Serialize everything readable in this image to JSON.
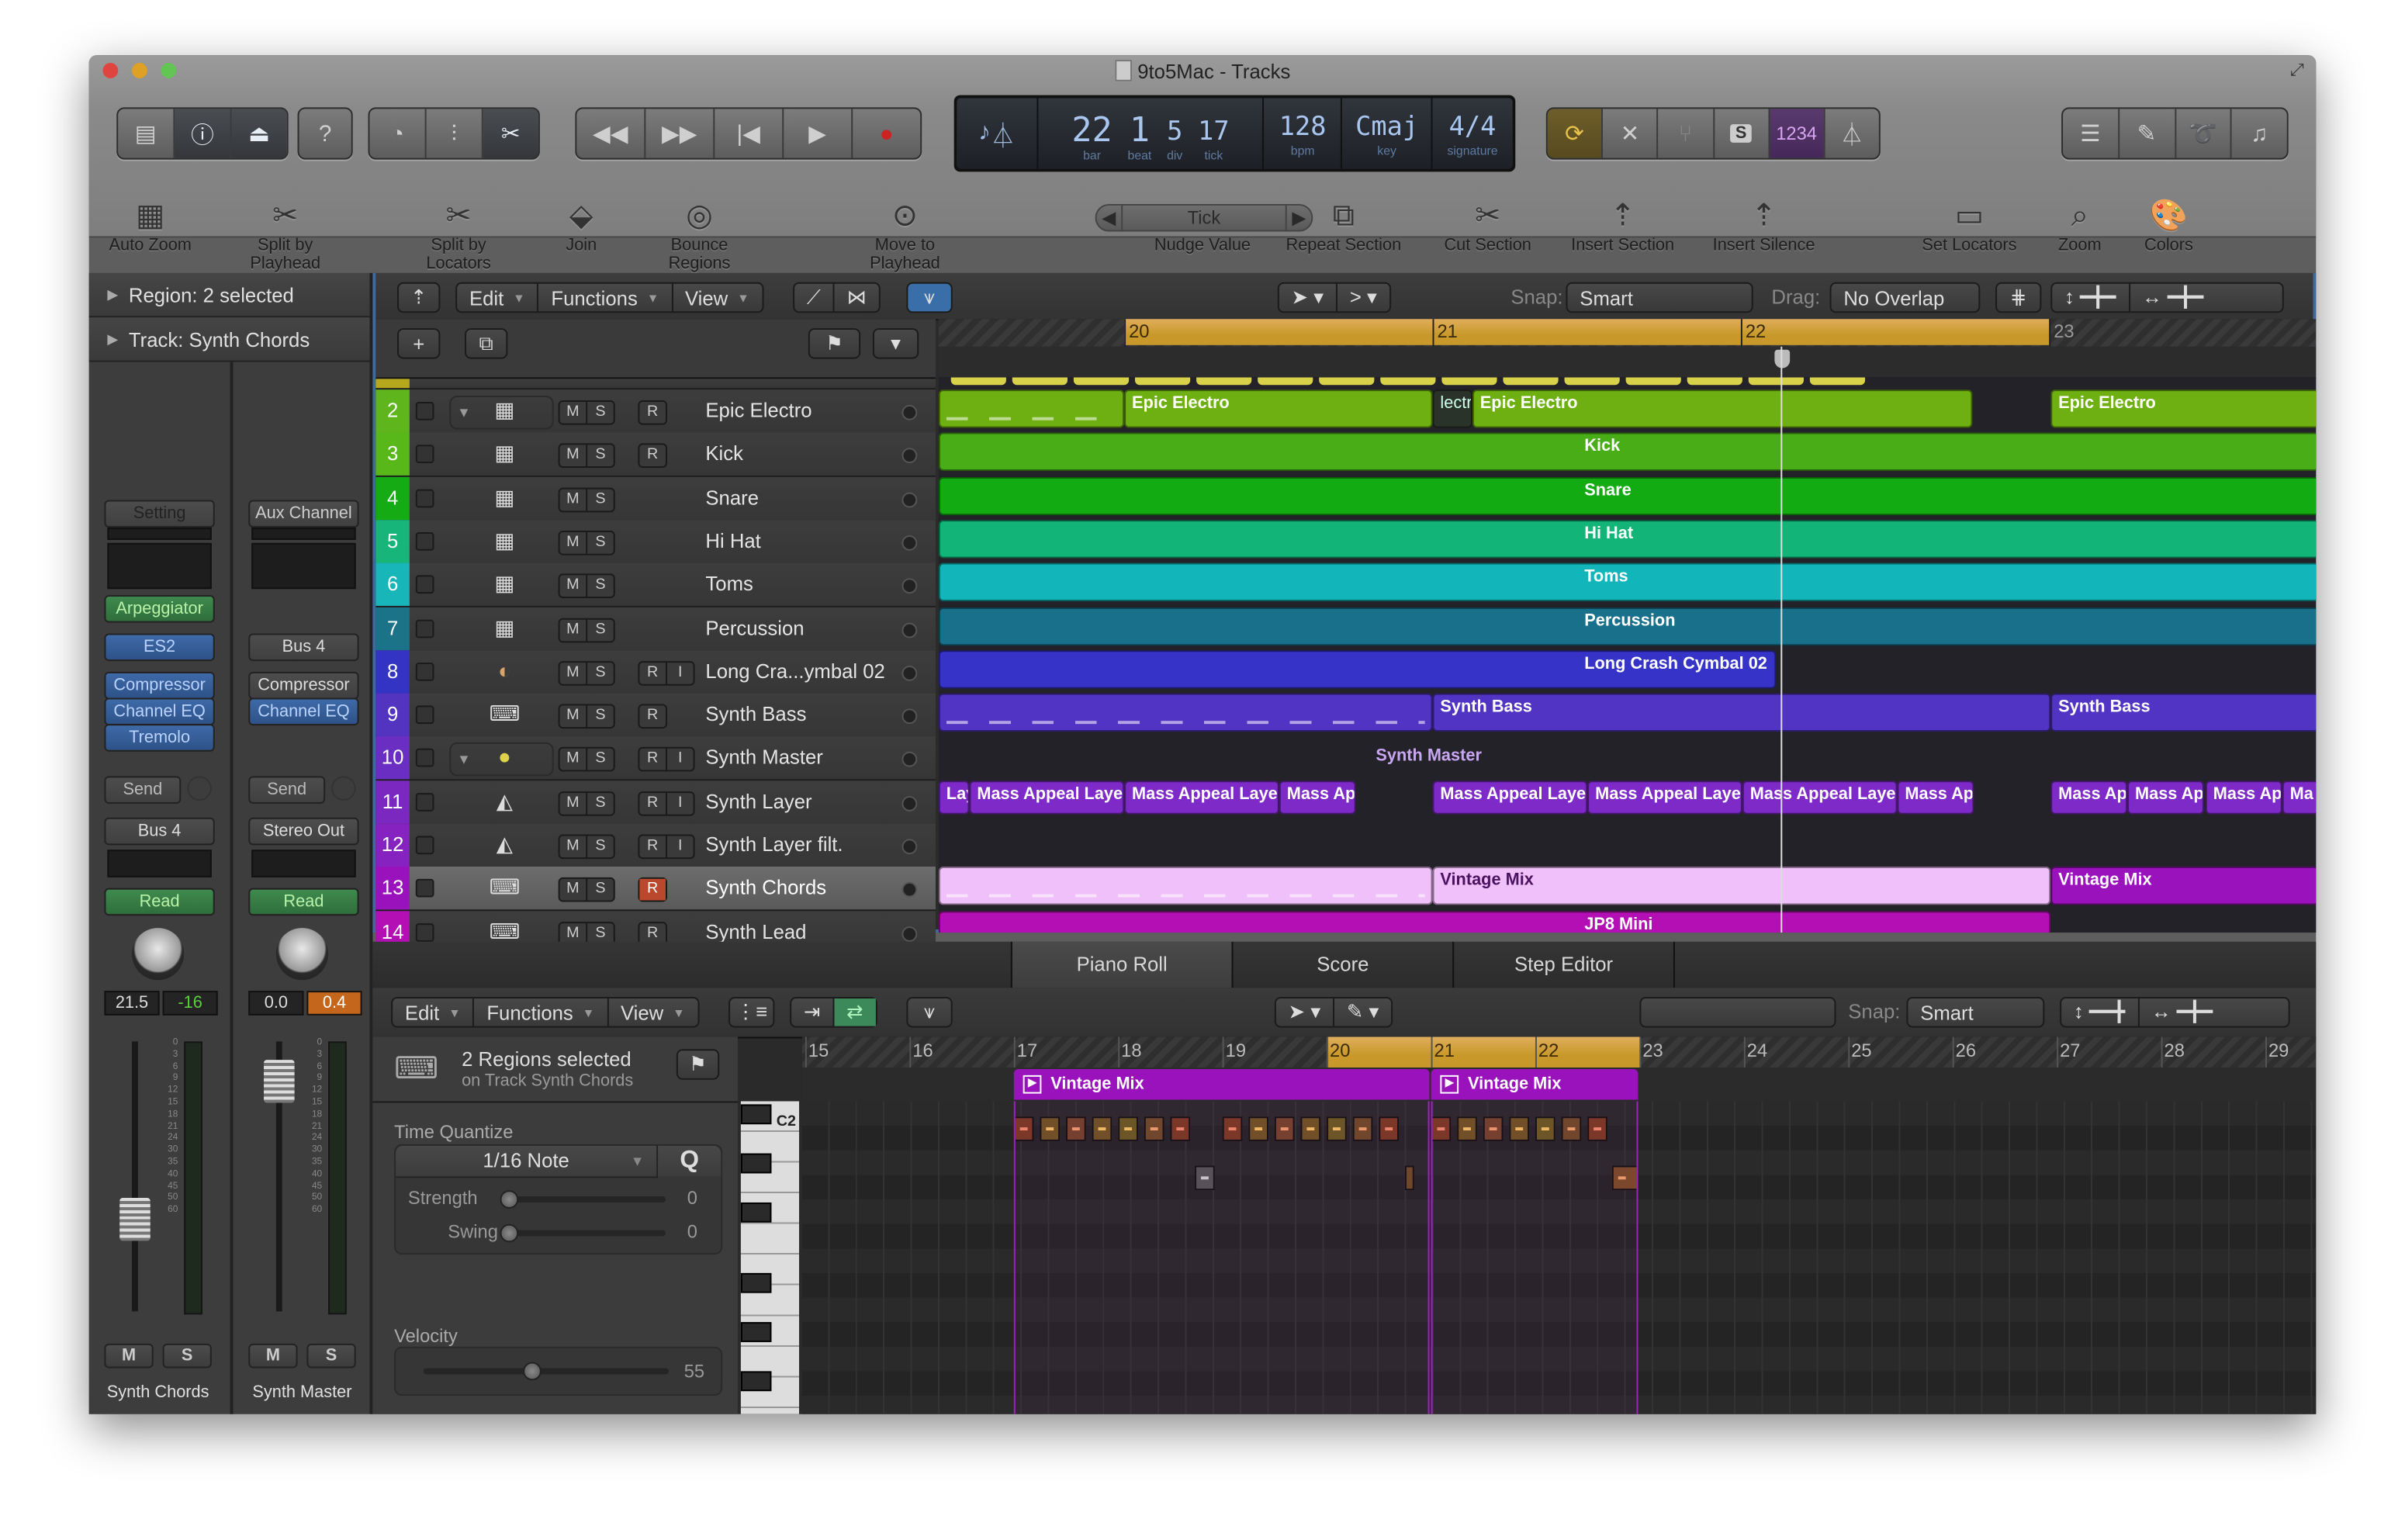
{
  "window": {
    "title": "9to5Mac - Tracks",
    "doc_icon": "project-file-icon"
  },
  "control_bar": {
    "left_buttons": [
      "library-icon",
      "inspector-icon",
      "toolbar-icon"
    ],
    "help_button": "help-icon",
    "view_buttons": [
      "smart-controls-icon",
      "mixer-icon",
      "editors-icon"
    ],
    "transport": [
      "rewind-icon",
      "fast-forward-icon",
      "go-to-beginning-icon",
      "play-icon",
      "record-icon"
    ],
    "lcd": {
      "bar": "22",
      "beat": "1",
      "div": "5",
      "tick": "17",
      "bpm": "128",
      "key": "Cmaj",
      "signature_num": "4",
      "signature_den": "4",
      "labels": {
        "bar": "bar",
        "beat": "beat",
        "div": "div",
        "tick": "tick",
        "bpm": "bpm",
        "key": "key",
        "signature": "signature"
      }
    },
    "mode_buttons": {
      "cycle": "cycle-icon",
      "replace": "replace-icon",
      "tuner": "tuner-icon",
      "solo": "S",
      "count_in": "1234",
      "metronome": "metronome-icon"
    },
    "right_buttons": [
      "list-editors-icon",
      "notepad-icon",
      "loop-browser-icon",
      "media-browser-icon"
    ]
  },
  "toolbar": {
    "items": [
      {
        "label": "Auto Zoom",
        "icon": "auto-zoom-icon"
      },
      {
        "label": "Split by Playhead",
        "icon": "scissors-icon"
      },
      {
        "label": "Split by Locators",
        "icon": "scissors-locators-icon"
      },
      {
        "label": "Join",
        "icon": "glue-icon"
      },
      {
        "label": "Bounce Regions",
        "icon": "bounce-icon"
      },
      {
        "label": "Move to Playhead",
        "icon": "move-to-playhead-icon"
      },
      {
        "label": "Repeat Section",
        "icon": "repeat-section-icon"
      },
      {
        "label": "Cut Section",
        "icon": "cut-section-icon"
      },
      {
        "label": "Insert Section",
        "icon": "insert-section-icon"
      },
      {
        "label": "Insert Silence",
        "icon": "insert-silence-icon"
      },
      {
        "label": "Set Locators",
        "icon": "set-locators-icon"
      },
      {
        "label": "Zoom",
        "icon": "zoom-icon"
      },
      {
        "label": "Colors",
        "icon": "palette-icon"
      }
    ],
    "nudge": {
      "value": "Tick",
      "label": "Nudge Value"
    }
  },
  "inspector": {
    "region_header": "Region: 2 selected",
    "track_header": "Track:  Synth Chords",
    "strips": [
      {
        "top_button": "Setting",
        "midi_fx": "Arpeggiator",
        "instrument": "ES2",
        "inserts": [
          "Compressor",
          "Channel EQ",
          "Tremolo"
        ],
        "send": "Send",
        "output": "Bus 4",
        "automation": "Read",
        "volume": "21.5",
        "peak": "-16",
        "fader_db": -21.5,
        "meter_scale": [
          "0",
          "3",
          "6",
          "9",
          "12",
          "15",
          "18",
          "21",
          "24",
          "30",
          "35",
          "40",
          "45",
          "50",
          "60"
        ],
        "mute": "M",
        "solo": "S",
        "name": "Synth Chords"
      },
      {
        "top_button": "Aux Channel",
        "input": "Bus 4",
        "inserts": [
          "Compressor",
          "Channel EQ"
        ],
        "send": "Send",
        "output": "Stereo Out",
        "automation": "Read",
        "volume": "0.0",
        "peak": "0.4",
        "fader_db": 0.0,
        "meter_scale": [
          "0",
          "3",
          "6",
          "9",
          "12",
          "15",
          "18",
          "21",
          "24",
          "30",
          "35",
          "40",
          "45",
          "50",
          "60"
        ],
        "mute": "M",
        "solo": "S",
        "name": "Synth Master"
      }
    ]
  },
  "tracks_area": {
    "menus": [
      "Edit",
      "Functions",
      "View"
    ],
    "snap_label": "Snap:",
    "snap_value": "Smart",
    "drag_label": "Drag:",
    "drag_value": "No Overlap",
    "ruler_bars": [
      "20",
      "21",
      "22",
      "23"
    ],
    "cycle_range": [
      "20",
      "23"
    ],
    "playhead_position": "22 1 5 17",
    "tracks": [
      {
        "num": "2",
        "name": "Epic Electro",
        "color": "#5fb51c",
        "icon": "drum-machine-icon",
        "buttons": [
          "M",
          "S",
          "R"
        ],
        "folder": true
      },
      {
        "num": "3",
        "name": "Kick",
        "color": "#58b81a",
        "icon": "drum-machine-icon",
        "buttons": [
          "M",
          "S",
          "R"
        ]
      },
      {
        "num": "4",
        "name": "Snare",
        "color": "#14ab14",
        "icon": "drum-machine-icon",
        "buttons": [
          "M",
          "S"
        ]
      },
      {
        "num": "5",
        "name": "Hi Hat",
        "color": "#17b57a",
        "icon": "drum-machine-icon",
        "buttons": [
          "M",
          "S"
        ]
      },
      {
        "num": "6",
        "name": "Toms",
        "color": "#19b6b9",
        "icon": "drum-machine-icon",
        "buttons": [
          "M",
          "S"
        ]
      },
      {
        "num": "7",
        "name": "Percussion",
        "color": "#1b7389",
        "icon": "drum-machine-icon",
        "buttons": [
          "M",
          "S"
        ]
      },
      {
        "num": "8",
        "name": "Long Cra...ymbal 02",
        "color": "#3434c4",
        "icon": "cymbal-icon",
        "buttons": [
          "M",
          "S",
          "R",
          "I"
        ]
      },
      {
        "num": "9",
        "name": "Synth Bass",
        "color": "#5234c0",
        "icon": "synth-keyboard-icon",
        "buttons": [
          "M",
          "S",
          "R"
        ]
      },
      {
        "num": "10",
        "name": "Synth Master",
        "color": "#6a2ec2",
        "icon": "aux-icon",
        "buttons": [
          "M",
          "S",
          "R",
          "I"
        ],
        "folder": true
      },
      {
        "num": "11",
        "name": "Synth Layer",
        "color": "#7a28c0",
        "icon": "speaker-icon",
        "buttons": [
          "M",
          "S",
          "R",
          "I"
        ]
      },
      {
        "num": "12",
        "name": "Synth Layer filt.",
        "color": "#8522c0",
        "icon": "speaker-icon",
        "buttons": [
          "M",
          "S",
          "R",
          "I"
        ]
      },
      {
        "num": "13",
        "name": "Synth Chords",
        "color": "#9a12bc",
        "icon": "synth-keyboard-icon",
        "buttons": [
          "M",
          "S",
          "R"
        ],
        "selected": true,
        "record_armed": true
      },
      {
        "num": "14",
        "name": "Synth Lead",
        "color": "#b40fb4",
        "icon": "synth-keyboard-icon",
        "buttons": [
          "M",
          "S",
          "R"
        ]
      }
    ],
    "regions": {
      "epic_electro": [
        "Epic Electro",
        "lectr",
        "Epic Electro",
        "Epic Electro"
      ],
      "kick": "Kick",
      "snare": "Snare",
      "hihat": "Hi Hat",
      "toms": "Toms",
      "percussion": "Percussion",
      "crash": "Long Crash Cymbal 02",
      "bass": [
        "Synth Bass",
        "Synth Bass"
      ],
      "master": "Synth Master",
      "layer": [
        "Laye",
        "Mass Appeal Laye",
        "Mass Appeal Laye",
        "Mass Ap",
        "Mass Appeal Laye",
        "Mass Appeal Laye",
        "Mass Appeal Laye",
        "Mass Ap",
        "Mass Ap",
        "Mass Ap",
        "Mass Ap",
        "Ma"
      ],
      "chords": [
        "Vintage Mix",
        "Vintage Mix"
      ],
      "lead": "JP8 Mini"
    }
  },
  "editor": {
    "tabs": [
      {
        "label": "Piano Roll",
        "active": true
      },
      {
        "label": "Score",
        "active": false
      },
      {
        "label": "Step Editor",
        "active": false
      }
    ],
    "menus": [
      "Edit",
      "Functions",
      "View"
    ],
    "snap_label": "Snap:",
    "snap_value": "Smart",
    "selection_title": "2 Regions selected",
    "selection_sub": "on Track Synth Chords",
    "time_quantize_label": "Time Quantize",
    "quantize_value": "1/16 Note",
    "quantize_button": "Q",
    "strength_label": "Strength",
    "strength_value": "0",
    "swing_label": "Swing",
    "swing_value": "0",
    "velocity_label": "Velocity",
    "velocity_value": "55",
    "key_label": "C2",
    "ruler_bars": [
      "15",
      "16",
      "17",
      "18",
      "19",
      "20",
      "21",
      "22",
      "23",
      "24",
      "25",
      "26",
      "27",
      "28",
      "29"
    ],
    "cycle_range": [
      "20",
      "23"
    ],
    "regions": [
      "Vintage Mix",
      "Vintage Mix"
    ]
  }
}
